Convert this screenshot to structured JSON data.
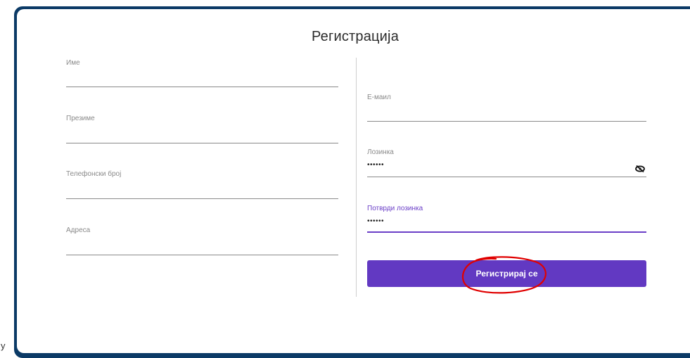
{
  "form": {
    "title": "Регистрација",
    "left_fields": [
      {
        "label": "Име",
        "value": ""
      },
      {
        "label": "Презиме",
        "value": ""
      },
      {
        "label": "Телефонски број",
        "value": ""
      },
      {
        "label": "Адреса",
        "value": ""
      }
    ],
    "right_fields": [
      {
        "label": "Е-маил",
        "value": ""
      },
      {
        "label": "Лозинка",
        "value": "••••••"
      },
      {
        "label": "Потврди лозинка",
        "value": "••••••"
      }
    ],
    "submit_label": "Регистрирај се",
    "password_toggle_icon": "eye-off-icon"
  },
  "stray_text": "y",
  "colors": {
    "frame": "#0b3a66",
    "accent": "#6239c2",
    "annotation": "#e00000"
  }
}
